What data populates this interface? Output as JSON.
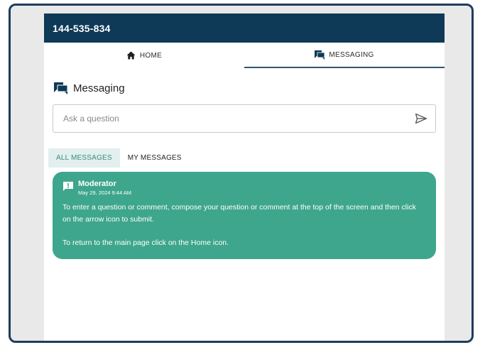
{
  "header": {
    "title": "144-535-834"
  },
  "nav": {
    "tabs": [
      {
        "label": "HOME",
        "icon": "home-icon"
      },
      {
        "label": "MESSAGING",
        "icon": "chat-icon"
      }
    ]
  },
  "messaging": {
    "title": "Messaging",
    "ask": {
      "placeholder": "Ask a question",
      "value": ""
    },
    "tabs": [
      {
        "label": "ALL MESSAGES",
        "active": true
      },
      {
        "label": "MY MESSAGES",
        "active": false
      }
    ],
    "messages": [
      {
        "author": "Moderator",
        "date": "May 29, 2024 9:44 AM",
        "paragraphs": [
          "To enter a question or comment, compose your question or comment at the top of the screen and then click on the arrow icon to submit.",
          "To return to the main page click on the Home icon."
        ]
      }
    ]
  },
  "colors": {
    "header_bg": "#0e3957",
    "frame_border": "#1e3d5c",
    "bubble_bg": "#3ea68c",
    "active_tab_bg": "#e2efee",
    "active_tab_text": "#3a8c7f"
  }
}
